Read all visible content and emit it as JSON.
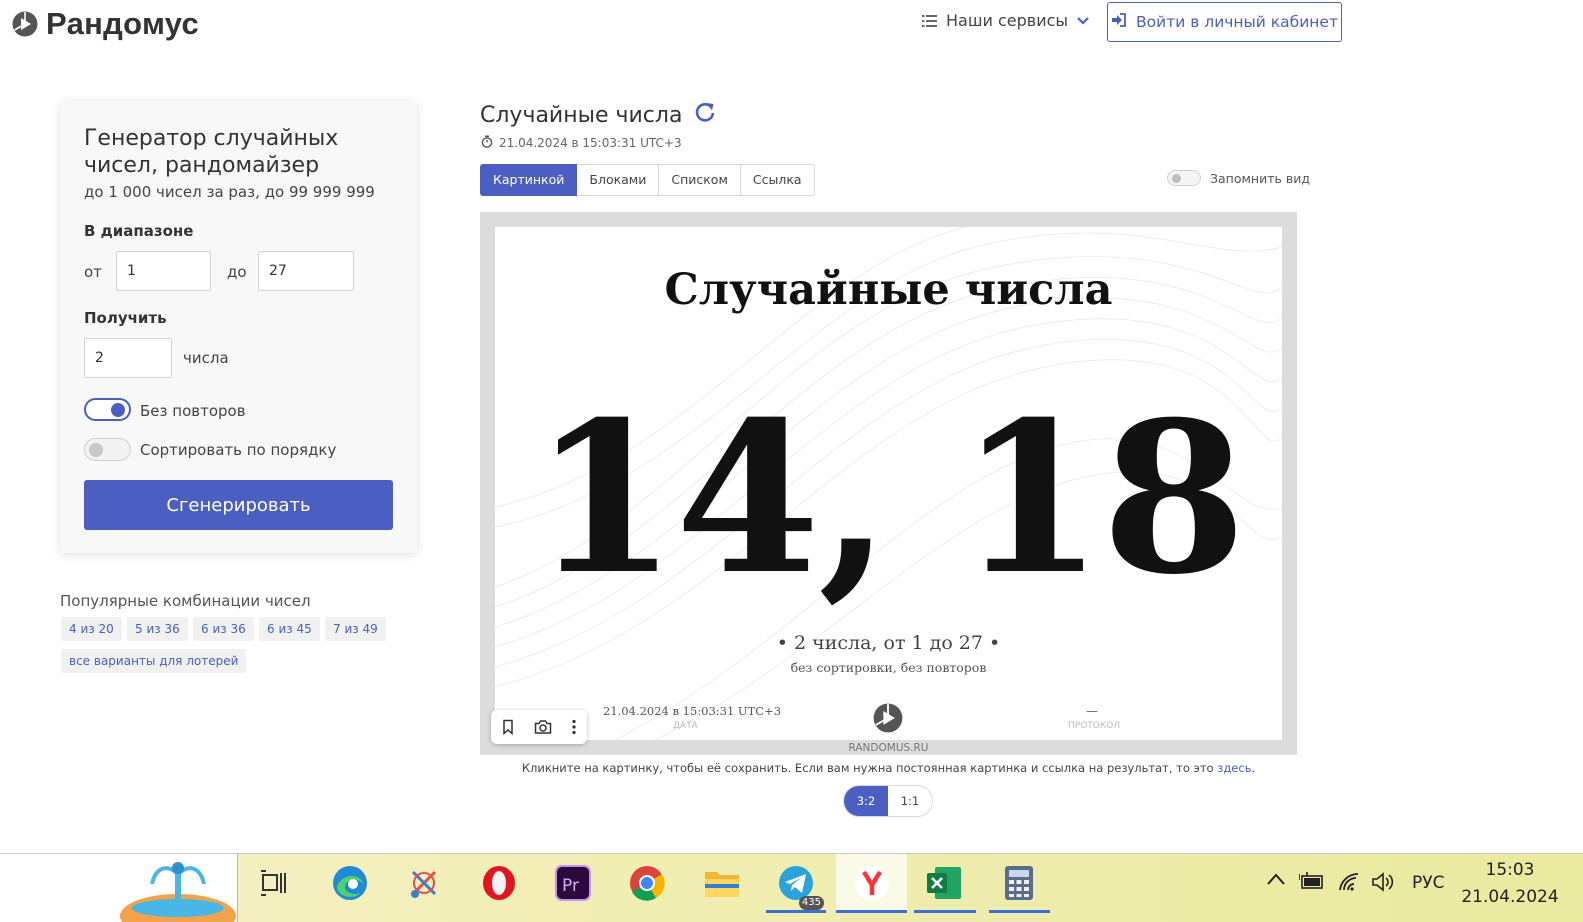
{
  "header": {
    "logo_text": "Рандомус",
    "services_label": "Наши сервисы",
    "login_label": "Войти в личный кабинет"
  },
  "generator": {
    "title": "Генератор случайных чисел, рандомайзер",
    "subtitle": "до 1 000 чисел за раз, до 99 999 999",
    "range_label": "В диапазоне",
    "from_label": "от",
    "from_value": "1",
    "to_label": "до",
    "to_value": "27",
    "get_label": "Получить",
    "count_value": "2",
    "count_unit": "числа",
    "no_repeat_label": "Без повторов",
    "no_repeat_on": true,
    "sort_label": "Сортировать по порядку",
    "sort_on": false,
    "generate_label": "Сгенерировать"
  },
  "popular": {
    "title": "Популярные комбинации чисел",
    "chips": [
      "4 из 20",
      "5 из 36",
      "6 из 36",
      "6 из 45",
      "7 из 49",
      "все варианты для лотерей"
    ]
  },
  "result": {
    "title": "Случайные числа",
    "timestamp": "21.04.2024 в 15:03:31 UTC+3",
    "tabs": [
      "Картинкой",
      "Блоками",
      "Списком",
      "Ссылка"
    ],
    "active_tab": "Картинкой",
    "remember_label": "Запомнить вид",
    "picture": {
      "title": "Случайные числа",
      "numbers": "14, 18",
      "summary": "•  2 числа, от 1 до 27  •",
      "flags": "без сортировки, без повторов",
      "date": "21.04.2024 в 15:03:31 UTC+3",
      "date_caption": "ДАТА",
      "protocol_value": "—",
      "protocol_caption": "ПРОТОКОЛ",
      "site": "RANDOMUS.RU"
    },
    "hint_text": "Кликните на картинку, чтобы её сохранить. Если вам нужна постоянная картинка и ссылка на результат, то это ",
    "hint_link": "здесь",
    "hint_end": ".",
    "ratios": [
      "3:2",
      "1:1"
    ],
    "active_ratio": "3:2"
  },
  "taskbar": {
    "apps": [
      "task-view",
      "edge",
      "paint",
      "opera",
      "premiere",
      "chrome",
      "explorer",
      "telegram",
      "yandex-browser",
      "excel",
      "calculator"
    ],
    "telegram_badge": "435",
    "language": "РУС",
    "time": "15:03",
    "date": "21.04.2024"
  },
  "colors": {
    "accent": "#4a5fc1",
    "text": "#333333",
    "taskbar": "#f1eeb3"
  }
}
